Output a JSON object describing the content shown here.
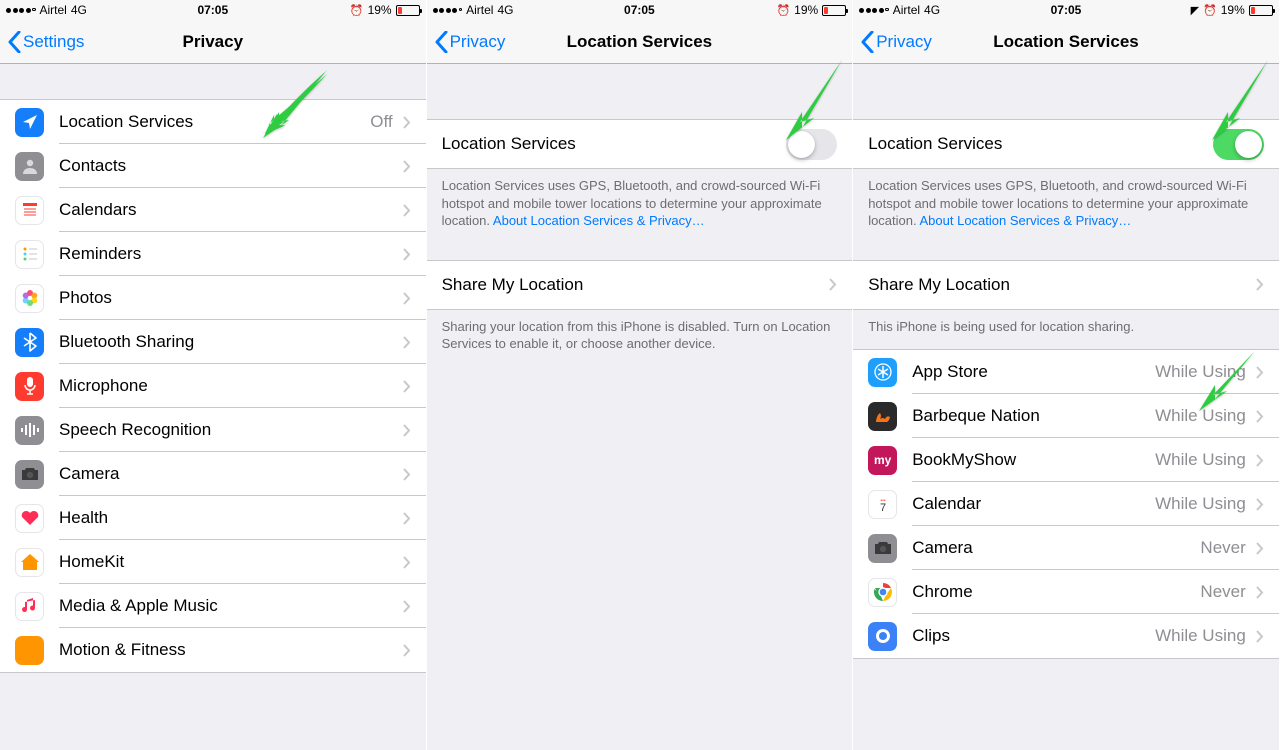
{
  "status": {
    "carrier": "Airtel",
    "network": "4G",
    "time": "07:05",
    "alarm": "⏰",
    "battery_pct": "19%",
    "loc_arrow": "➤"
  },
  "s1": {
    "back": "Settings",
    "title": "Privacy",
    "rows": [
      {
        "label": "Location Services",
        "detail": "Off",
        "icon": "location-arrow-icon"
      },
      {
        "label": "Contacts",
        "icon": "contacts-icon"
      },
      {
        "label": "Calendars",
        "icon": "calendars-icon"
      },
      {
        "label": "Reminders",
        "icon": "reminders-icon"
      },
      {
        "label": "Photos",
        "icon": "photos-icon"
      },
      {
        "label": "Bluetooth Sharing",
        "icon": "bluetooth-icon"
      },
      {
        "label": "Microphone",
        "icon": "microphone-icon"
      },
      {
        "label": "Speech Recognition",
        "icon": "speech-icon"
      },
      {
        "label": "Camera",
        "icon": "camera-icon"
      },
      {
        "label": "Health",
        "icon": "health-icon"
      },
      {
        "label": "HomeKit",
        "icon": "homekit-icon"
      },
      {
        "label": "Media & Apple Music",
        "icon": "music-icon"
      },
      {
        "label": "Motion & Fitness",
        "icon": "motion-icon"
      }
    ]
  },
  "s2": {
    "back": "Privacy",
    "title": "Location Services",
    "toggle_label": "Location Services",
    "toggle_on": false,
    "footer1a": "Location Services uses GPS, Bluetooth, and crowd-sourced Wi-Fi hotspot and mobile tower locations to determine your approximate location. ",
    "footer1_link": "About Location Services & Privacy…",
    "share_label": "Share My Location",
    "footer2": "Sharing your location from this iPhone is disabled. Turn on Location Services to enable it, or choose another device."
  },
  "s3": {
    "back": "Privacy",
    "title": "Location Services",
    "toggle_label": "Location Services",
    "toggle_on": true,
    "footer1a": "Location Services uses GPS, Bluetooth, and crowd-sourced Wi-Fi hotspot and mobile tower locations to determine your approximate location. ",
    "footer1_link": "About Location Services & Privacy…",
    "share_label": "Share My Location",
    "footer2": "This iPhone is being used for location sharing.",
    "apps": [
      {
        "label": "App Store",
        "detail": "While Using",
        "icon": "appstore-icon"
      },
      {
        "label": "Barbeque Nation",
        "detail": "While Using",
        "icon": "bbq-icon"
      },
      {
        "label": "BookMyShow",
        "detail": "While Using",
        "icon": "bookmyshow-icon"
      },
      {
        "label": "Calendar",
        "detail": "While Using",
        "icon": "calendar-icon"
      },
      {
        "label": "Camera",
        "detail": "Never",
        "icon": "camera-icon"
      },
      {
        "label": "Chrome",
        "detail": "Never",
        "icon": "chrome-icon"
      },
      {
        "label": "Clips",
        "detail": "While Using",
        "icon": "clips-icon"
      }
    ]
  }
}
